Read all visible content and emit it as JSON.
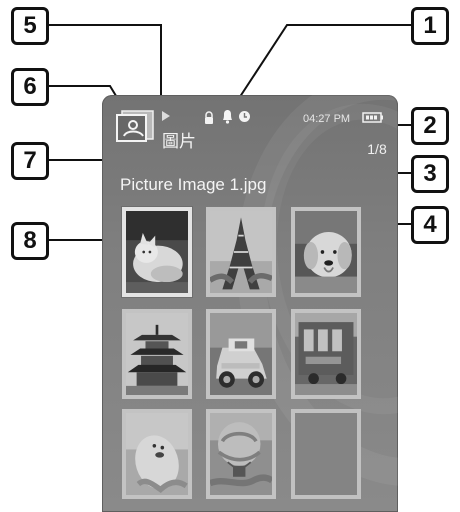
{
  "status_bar": {
    "time": "04:27 PM",
    "file_count": "1/8"
  },
  "header": {
    "mode_title": "圖片"
  },
  "selected_file": {
    "name": "Picture Image 1.jpg"
  },
  "thumbnails": [
    "Picture Image 1.jpg",
    "",
    "",
    "",
    "",
    "",
    "",
    "",
    ""
  ],
  "callouts": {
    "one": "1",
    "two": "2",
    "three": "3",
    "four": "4",
    "five": "5",
    "six": "6",
    "seven": "7",
    "eight": "8"
  },
  "icons": {
    "mode": "picture-mode-icon",
    "play": "play-icon",
    "lock": "lock-icon",
    "alarm": "bell-icon",
    "sleep": "clock-icon",
    "battery": "battery-icon"
  },
  "colors": {
    "screen": "#7b7b7b",
    "callout_border": "#111111",
    "text": "#f4f4f4"
  }
}
